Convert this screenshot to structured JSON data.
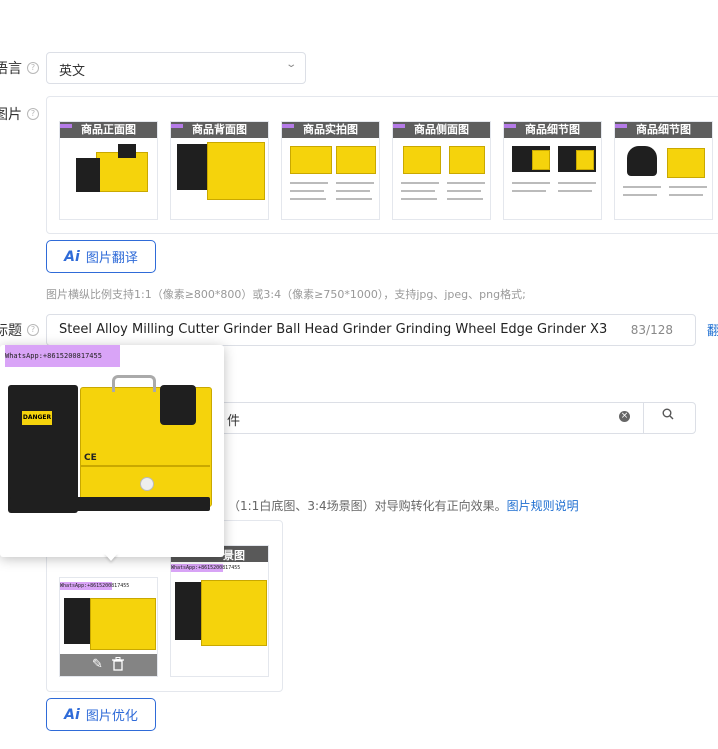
{
  "language": {
    "label": "语言",
    "value": "英文",
    "help": "?"
  },
  "images": {
    "label": "图片",
    "thumbs": [
      "商品正面图",
      "商品背面图",
      "商品实拍图",
      "商品侧面图",
      "商品细节图",
      "商品细节图"
    ],
    "translate_button": {
      "ai": "Ai",
      "label": "图片翻译"
    },
    "hint": "图片横纵比例支持1:1（像素≥800*800）或3:4（像素≥750*1000），支持jpg、jpeg、png格式;"
  },
  "title_field": {
    "label": "标题",
    "value": "Steel Alloy Milling Cutter Grinder Ball Head Grinder Grinding Wheel Edge Grinder X3",
    "count": "83/128",
    "side_link": "翻"
  },
  "search": {
    "partial_text": "件"
  },
  "main_image_hint": {
    "text": "（1:1白底图、3:4场景图）对导购转化有正向效果。",
    "link": "图片规则说明"
  },
  "main_images": {
    "scene_cap": "景图"
  },
  "optimize_button": {
    "ai": "Ai",
    "label": "图片优化"
  },
  "popup": {
    "watermark": "WhatsApp:+8615200817455",
    "ce_mark": "CE",
    "danger": "DANGER"
  },
  "small_watermark": "WhatsApp:+8615200817455",
  "colors": {
    "accent": "#2f6bd8",
    "machine_yellow": "#f5d30c",
    "watermark_purple": "#d9a4f7"
  }
}
